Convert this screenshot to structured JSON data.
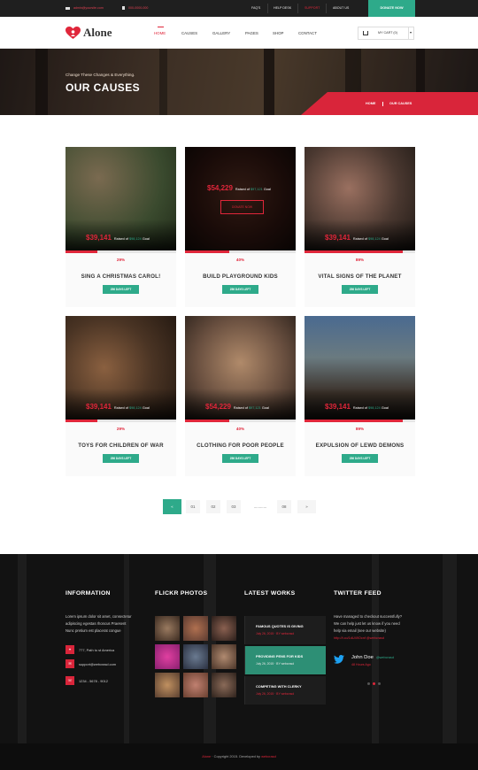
{
  "topbar": {
    "email": "admin@yoursite.com",
    "phone": "000-0000-000",
    "links": [
      "FAQ'S",
      "HELP DESK",
      "SUPPORT",
      "ABOUT US"
    ],
    "donate": "DONATE NOW"
  },
  "header": {
    "logo": "Alone",
    "nav": [
      "HOME",
      "CAUSES",
      "GALLERY",
      "PAGES",
      "SHOP",
      "CONTACT"
    ],
    "cart": "MY CART (0)"
  },
  "hero": {
    "subtitle": "Change These Changes & Everything.",
    "title": "OUR CAUSES",
    "breadcrumb": [
      "HOME",
      "OUR CAUSES"
    ]
  },
  "causes": [
    {
      "raised": "$39,141",
      "raised_label": "Raised of",
      "goal": "$98,124",
      "goal_label": "Goal",
      "percent": "29%",
      "progress": 0.29,
      "title": "SING A CHRISTMAS CAROL!",
      "days": "256 DAYS LEFT"
    },
    {
      "raised": "$54,229",
      "raised_label": "Raised of",
      "goal": "$97,121",
      "goal_label": "Goal",
      "percent": "40%",
      "progress": 0.4,
      "title": "BUILD PLAYGROUND KIDS",
      "days": "256 DAYS LEFT",
      "button": "DONATE NOW"
    },
    {
      "raised": "$39,141",
      "raised_label": "Raised of",
      "goal": "$98,124",
      "goal_label": "Goal",
      "percent": "89%",
      "progress": 0.89,
      "title": "VITAL SIGNS OF THE PLANET",
      "days": "256 DAYS LEFT"
    },
    {
      "raised": "$39,141",
      "raised_label": "Raised of",
      "goal": "$98,124",
      "goal_label": "Goal",
      "percent": "29%",
      "progress": 0.29,
      "title": "TOYS FOR CHILDREN OF WAR",
      "days": "256 DAYS LEFT"
    },
    {
      "raised": "$54,229",
      "raised_label": "Raised of",
      "goal": "$97,121",
      "goal_label": "Goal",
      "percent": "40%",
      "progress": 0.4,
      "title": "CLOTHING FOR POOR PEOPLE",
      "days": "256 DAYS LEFT"
    },
    {
      "raised": "$39,141",
      "raised_label": "Raised of",
      "goal": "$98,124",
      "goal_label": "Goal",
      "percent": "89%",
      "progress": 0.89,
      "title": "EXPULSION OF LEWD DEMONS",
      "days": "256 DAYS LEFT"
    }
  ],
  "pagination": [
    "«",
    "01",
    "02",
    "03",
    "............",
    "08",
    "»"
  ],
  "footer": {
    "info": {
      "title": "INFORMATION",
      "text": [
        "Lorem ipsum dolor sit amet, consectetur",
        "adipiscing egestas rhoncus Praesent",
        "Nunc pretium est placerat congue"
      ],
      "address": "777, Path to st America",
      "email": "support@webcrasd.com",
      "phone": "1234 - 5678 - 9012"
    },
    "flickr": {
      "title": "FLICKR PHOTOS"
    },
    "works": {
      "title": "LATEST WORKS",
      "items": [
        {
          "title": "FAMOUS QUOTES IS GIVING",
          "meta": "July 26, 2015 · BY webcrasd"
        },
        {
          "title": "PROVIDING PENS FOR KIDS",
          "meta": "July 26, 2015 · BY webcrasd"
        },
        {
          "title": "COMPETING WITH CLERKY",
          "meta": "July 26, 2015 · BY webcrasd"
        }
      ]
    },
    "twitter": {
      "title": "TWITTER FEED",
      "text": [
        "Have managed to checkout successfully?",
        "We can help just let us know if you need",
        "help via email (see our website)"
      ],
      "link": "http://t.co/1dU49Ocnf @webcrasd",
      "name": "John Doe",
      "handle": "@webcrasd",
      "time": "48 Hours Ago"
    }
  },
  "copyright": {
    "brand": "Alone",
    "text": "· Copyright 2015. Developed by",
    "dev": "webcrasd"
  },
  "colors": {
    "accent_red": "#e0263a",
    "accent_green": "#2eaa8a",
    "dark": "#1f1f1f"
  }
}
